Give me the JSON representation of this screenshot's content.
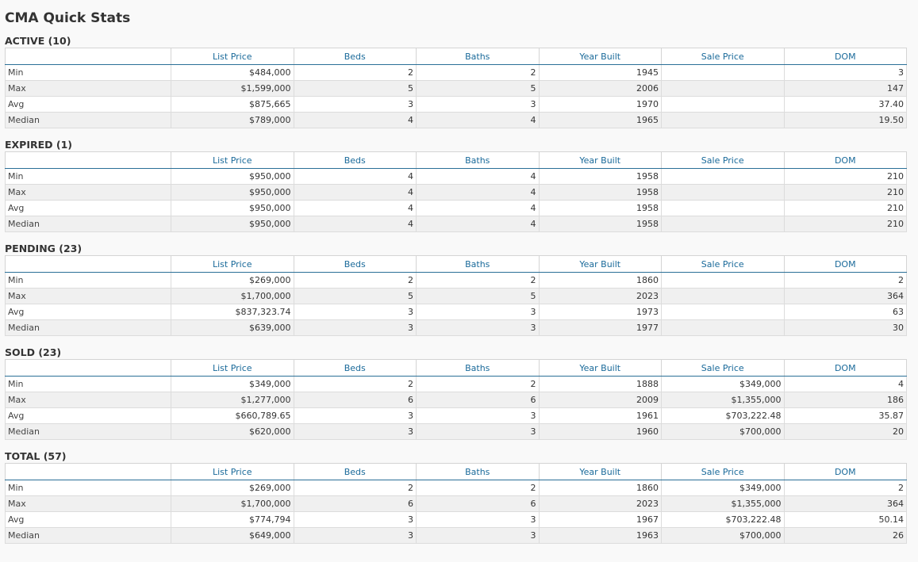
{
  "title": "CMA Quick Stats",
  "columns": [
    "List Price",
    "Beds",
    "Baths",
    "Year Built",
    "Sale Price",
    "DOM"
  ],
  "sections": [
    {
      "title": "ACTIVE (10)",
      "rows": [
        {
          "label": "Min",
          "cells": [
            "$484,000",
            "2",
            "2",
            "1945",
            "",
            "3"
          ]
        },
        {
          "label": "Max",
          "cells": [
            "$1,599,000",
            "5",
            "5",
            "2006",
            "",
            "147"
          ]
        },
        {
          "label": "Avg",
          "cells": [
            "$875,665",
            "3",
            "3",
            "1970",
            "",
            "37.40"
          ]
        },
        {
          "label": "Median",
          "cells": [
            "$789,000",
            "4",
            "4",
            "1965",
            "",
            "19.50"
          ]
        }
      ]
    },
    {
      "title": "EXPIRED (1)",
      "rows": [
        {
          "label": "Min",
          "cells": [
            "$950,000",
            "4",
            "4",
            "1958",
            "",
            "210"
          ]
        },
        {
          "label": "Max",
          "cells": [
            "$950,000",
            "4",
            "4",
            "1958",
            "",
            "210"
          ]
        },
        {
          "label": "Avg",
          "cells": [
            "$950,000",
            "4",
            "4",
            "1958",
            "",
            "210"
          ]
        },
        {
          "label": "Median",
          "cells": [
            "$950,000",
            "4",
            "4",
            "1958",
            "",
            "210"
          ]
        }
      ]
    },
    {
      "title": "PENDING (23)",
      "rows": [
        {
          "label": "Min",
          "cells": [
            "$269,000",
            "2",
            "2",
            "1860",
            "",
            "2"
          ]
        },
        {
          "label": "Max",
          "cells": [
            "$1,700,000",
            "5",
            "5",
            "2023",
            "",
            "364"
          ]
        },
        {
          "label": "Avg",
          "cells": [
            "$837,323.74",
            "3",
            "3",
            "1973",
            "",
            "63"
          ]
        },
        {
          "label": "Median",
          "cells": [
            "$639,000",
            "3",
            "3",
            "1977",
            "",
            "30"
          ]
        }
      ]
    },
    {
      "title": "SOLD (23)",
      "rows": [
        {
          "label": "Min",
          "cells": [
            "$349,000",
            "2",
            "2",
            "1888",
            "$349,000",
            "4"
          ]
        },
        {
          "label": "Max",
          "cells": [
            "$1,277,000",
            "6",
            "6",
            "2009",
            "$1,355,000",
            "186"
          ]
        },
        {
          "label": "Avg",
          "cells": [
            "$660,789.65",
            "3",
            "3",
            "1961",
            "$703,222.48",
            "35.87"
          ]
        },
        {
          "label": "Median",
          "cells": [
            "$620,000",
            "3",
            "3",
            "1960",
            "$700,000",
            "20"
          ]
        }
      ]
    },
    {
      "title": "TOTAL (57)",
      "rows": [
        {
          "label": "Min",
          "cells": [
            "$269,000",
            "2",
            "2",
            "1860",
            "$349,000",
            "2"
          ]
        },
        {
          "label": "Max",
          "cells": [
            "$1,700,000",
            "6",
            "6",
            "2023",
            "$1,355,000",
            "364"
          ]
        },
        {
          "label": "Avg",
          "cells": [
            "$774,794",
            "3",
            "3",
            "1967",
            "$703,222.48",
            "50.14"
          ]
        },
        {
          "label": "Median",
          "cells": [
            "$649,000",
            "3",
            "3",
            "1963",
            "$700,000",
            "26"
          ]
        }
      ]
    }
  ]
}
